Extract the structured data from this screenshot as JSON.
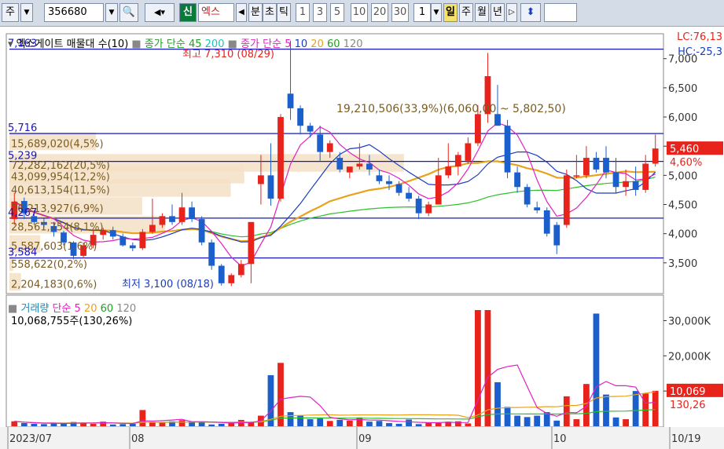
{
  "toolbar": {
    "market": "주",
    "code": "356680",
    "badge": "신",
    "name": "엑스",
    "periods": [
      "분",
      "초",
      "틱"
    ],
    "nums": [
      "1",
      "3",
      "5",
      "10",
      "20",
      "30"
    ],
    "unit_value": "1",
    "day_tabs": [
      "일",
      "주",
      "월",
      "년"
    ]
  },
  "legend": {
    "title": "엑스게이트 매물대 수(10)",
    "ma_label": "종가 단순",
    "ma_values": [
      "45",
      "200"
    ],
    "ma2_label": "종가 단순",
    "ma2_values": [
      "5",
      "10",
      "20",
      "60",
      "120"
    ]
  },
  "price_tags": {
    "lc": "LC:76,13",
    "hc": "HC:-25,3",
    "current": "5,460",
    "change": "4,60%"
  },
  "annotations": {
    "high": "최고 7,310 (08/29)",
    "low": "최저 3,100 (08/18)",
    "range": "19,210,506(33,9%)(6,060,00 ~ 5,802,50)"
  },
  "hlines": [
    {
      "label": "7,163",
      "value": 7163
    },
    {
      "label": "5,716",
      "value": 5716
    },
    {
      "label": "5,239",
      "value": 5239
    },
    {
      "label": "4,267",
      "value": 4267
    },
    {
      "label": "3,584",
      "value": 3584
    }
  ],
  "volume_profile": [
    {
      "label": "15,689,020(4,5%)",
      "bucket": 5570
    },
    {
      "label": "72,282,162(20,5%)",
      "bucket": 5200
    },
    {
      "label": "43,099,954(12,2%)",
      "bucket": 5000
    },
    {
      "label": "40,613,154(11,5%)",
      "bucket": 4770
    },
    {
      "label": "26,213,927(6,9%)",
      "bucket": 4460
    },
    {
      "label": "28,561,754(8,1%)",
      "bucket": 4140
    },
    {
      "label": "5,587,603(1,6%)",
      "bucket": 3810
    },
    {
      "label": "558,622(0,2%)",
      "bucket": 3500
    },
    {
      "label": "2,204,183(0,6%)",
      "bucket": 3160
    }
  ],
  "volume_legend": {
    "title": "거래량",
    "ma_label": "단순",
    "ma_values": [
      "5",
      "20",
      "60",
      "120"
    ],
    "current": "10,068,755주(130,26%)",
    "tag_value": "10,069",
    "tag_pct": "130,26"
  },
  "x_axis": [
    "2023/07",
    "08",
    "09",
    "10",
    "10/19"
  ],
  "colors": {
    "up": "#e8231c",
    "down": "#1a5fcc",
    "ma5": "#e020c0",
    "ma10": "#1a3dbf",
    "ma20": "#e8a21c",
    "ma60": "#2cc02c",
    "ma120": "#888888",
    "hline": "#1818b8"
  },
  "chart_data": {
    "type": "candlestick",
    "price_axis": {
      "min": 3000,
      "max": 7400,
      "ticks": [
        3500,
        4000,
        4500,
        5000,
        5500,
        6000,
        6500,
        7000
      ]
    },
    "volume_axis": {
      "min": 0,
      "max": 33000,
      "ticks": [
        10000,
        20000,
        30000
      ],
      "tick_labels": [
        "10,000K",
        "20,000K",
        "30,000K"
      ]
    },
    "candles": [
      {
        "o": 4250,
        "h": 4700,
        "l": 4150,
        "c": 4550,
        "v": 1400
      },
      {
        "o": 4560,
        "h": 4620,
        "l": 4250,
        "c": 4350,
        "v": 900
      },
      {
        "o": 4300,
        "h": 4400,
        "l": 4150,
        "c": 4200,
        "v": 700
      },
      {
        "o": 4200,
        "h": 4260,
        "l": 4100,
        "c": 4150,
        "v": 600
      },
      {
        "o": 4130,
        "h": 4200,
        "l": 3950,
        "c": 4030,
        "v": 900
      },
      {
        "o": 4020,
        "h": 4050,
        "l": 3800,
        "c": 3850,
        "v": 800
      },
      {
        "o": 3850,
        "h": 3870,
        "l": 3560,
        "c": 3620,
        "v": 1200
      },
      {
        "o": 3620,
        "h": 3850,
        "l": 3580,
        "c": 3800,
        "v": 1000
      },
      {
        "o": 3800,
        "h": 4060,
        "l": 3750,
        "c": 3980,
        "v": 700
      },
      {
        "o": 3980,
        "h": 4100,
        "l": 3900,
        "c": 4060,
        "v": 1300
      },
      {
        "o": 4060,
        "h": 4120,
        "l": 3900,
        "c": 3950,
        "v": 500
      },
      {
        "o": 3950,
        "h": 4000,
        "l": 3780,
        "c": 3800,
        "v": 600
      },
      {
        "o": 3800,
        "h": 3850,
        "l": 3700,
        "c": 3750,
        "v": 700
      },
      {
        "o": 3750,
        "h": 4080,
        "l": 3720,
        "c": 4030,
        "v": 4600
      },
      {
        "o": 4030,
        "h": 4600,
        "l": 4000,
        "c": 4150,
        "v": 1100
      },
      {
        "o": 4150,
        "h": 4350,
        "l": 4100,
        "c": 4300,
        "v": 1000
      },
      {
        "o": 4300,
        "h": 4500,
        "l": 4150,
        "c": 4200,
        "v": 1400
      },
      {
        "o": 4200,
        "h": 4700,
        "l": 4150,
        "c": 4450,
        "v": 1700
      },
      {
        "o": 4450,
        "h": 4550,
        "l": 4200,
        "c": 4250,
        "v": 1300
      },
      {
        "o": 4250,
        "h": 4300,
        "l": 3800,
        "c": 3850,
        "v": 1100
      },
      {
        "o": 3850,
        "h": 3900,
        "l": 3380,
        "c": 3450,
        "v": 500
      },
      {
        "o": 3450,
        "h": 3480,
        "l": 3110,
        "c": 3150,
        "v": 700
      },
      {
        "o": 3150,
        "h": 3320,
        "l": 3100,
        "c": 3290,
        "v": 1000
      },
      {
        "o": 3290,
        "h": 3550,
        "l": 3250,
        "c": 3480,
        "v": 1800
      },
      {
        "o": 3480,
        "h": 4150,
        "l": 3150,
        "c": 4200,
        "v": 1200
      },
      {
        "o": 4850,
        "h": 5350,
        "l": 4500,
        "c": 5000,
        "v": 3000
      },
      {
        "o": 5000,
        "h": 5550,
        "l": 4480,
        "c": 4600,
        "v": 14500
      },
      {
        "o": 4600,
        "h": 6050,
        "l": 4550,
        "c": 6000,
        "v": 18000
      },
      {
        "o": 6400,
        "h": 7310,
        "l": 5950,
        "c": 6150,
        "v": 4000
      },
      {
        "o": 6150,
        "h": 6200,
        "l": 5700,
        "c": 5850,
        "v": 3000
      },
      {
        "o": 5850,
        "h": 5900,
        "l": 5650,
        "c": 5750,
        "v": 2000
      },
      {
        "o": 5700,
        "h": 5850,
        "l": 5250,
        "c": 5400,
        "v": 2200
      },
      {
        "o": 5400,
        "h": 5600,
        "l": 5300,
        "c": 5550,
        "v": 1500
      },
      {
        "o": 5300,
        "h": 5400,
        "l": 5050,
        "c": 5100,
        "v": 1800
      },
      {
        "o": 5050,
        "h": 5100,
        "l": 4950,
        "c": 5150,
        "v": 1600
      },
      {
        "o": 5150,
        "h": 5550,
        "l": 5100,
        "c": 5200,
        "v": 2500
      },
      {
        "o": 5200,
        "h": 5350,
        "l": 5000,
        "c": 5100,
        "v": 1300
      },
      {
        "o": 5000,
        "h": 5100,
        "l": 4850,
        "c": 4900,
        "v": 1500
      },
      {
        "o": 4900,
        "h": 5000,
        "l": 4750,
        "c": 4850,
        "v": 900
      },
      {
        "o": 4850,
        "h": 4900,
        "l": 4650,
        "c": 4700,
        "v": 700
      },
      {
        "o": 4700,
        "h": 4800,
        "l": 4550,
        "c": 4600,
        "v": 1900
      },
      {
        "o": 4600,
        "h": 4650,
        "l": 4250,
        "c": 4350,
        "v": 600
      },
      {
        "o": 4350,
        "h": 4550,
        "l": 4300,
        "c": 4500,
        "v": 1000
      },
      {
        "o": 4500,
        "h": 5300,
        "l": 4500,
        "c": 5000,
        "v": 900
      },
      {
        "o": 5000,
        "h": 5550,
        "l": 4950,
        "c": 5150,
        "v": 1300
      },
      {
        "o": 5150,
        "h": 5400,
        "l": 5000,
        "c": 5350,
        "v": 1400
      },
      {
        "o": 5250,
        "h": 5650,
        "l": 5200,
        "c": 5550,
        "v": 800
      },
      {
        "o": 5550,
        "h": 6200,
        "l": 5500,
        "c": 6050,
        "v": 33000
      },
      {
        "o": 6050,
        "h": 7100,
        "l": 5900,
        "c": 6700,
        "v": 33000
      },
      {
        "o": 6050,
        "h": 6550,
        "l": 5900,
        "c": 5850,
        "v": 12500
      },
      {
        "o": 5850,
        "h": 5950,
        "l": 4950,
        "c": 5050,
        "v": 5500
      },
      {
        "o": 5050,
        "h": 5150,
        "l": 4700,
        "c": 4800,
        "v": 3000
      },
      {
        "o": 4800,
        "h": 4850,
        "l": 4450,
        "c": 4500,
        "v": 2600
      },
      {
        "o": 4450,
        "h": 4550,
        "l": 4350,
        "c": 4400,
        "v": 3000
      },
      {
        "o": 4400,
        "h": 4450,
        "l": 3950,
        "c": 4000,
        "v": 4000
      },
      {
        "o": 4150,
        "h": 4200,
        "l": 3650,
        "c": 3800,
        "v": 1600
      },
      {
        "o": 4150,
        "h": 5100,
        "l": 4100,
        "c": 5000,
        "v": 8500
      },
      {
        "o": 5000,
        "h": 5350,
        "l": 4950,
        "c": 5000,
        "v": 2000
      },
      {
        "o": 5000,
        "h": 5500,
        "l": 4950,
        "c": 5300,
        "v": 12000
      },
      {
        "o": 5300,
        "h": 5400,
        "l": 5050,
        "c": 5100,
        "v": 32000
      },
      {
        "o": 5300,
        "h": 5500,
        "l": 4950,
        "c": 5050,
        "v": 9000
      },
      {
        "o": 5050,
        "h": 5300,
        "l": 4700,
        "c": 4800,
        "v": 2500
      },
      {
        "o": 4800,
        "h": 5100,
        "l": 4650,
        "c": 4900,
        "v": 2000
      },
      {
        "o": 4900,
        "h": 5150,
        "l": 4650,
        "c": 4750,
        "v": 10000
      },
      {
        "o": 4750,
        "h": 5350,
        "l": 4700,
        "c": 5200,
        "v": 9300
      },
      {
        "o": 5200,
        "h": 5700,
        "l": 5150,
        "c": 5460,
        "v": 10069
      }
    ]
  }
}
